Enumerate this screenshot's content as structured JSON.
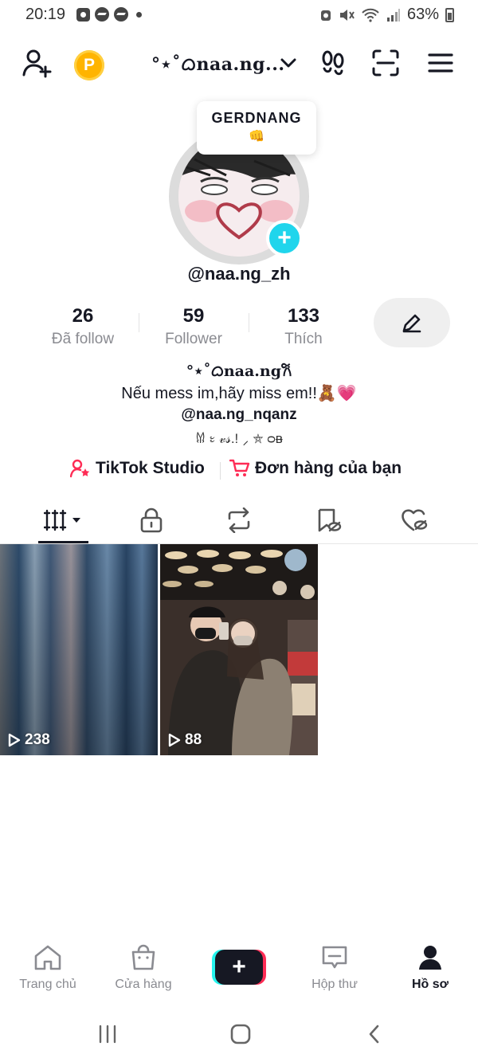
{
  "status_bar": {
    "time": "20:19",
    "battery": "63%"
  },
  "header": {
    "username": "°⋆˚ᜊnaa.ng..."
  },
  "profile": {
    "note": {
      "title": "GERDNANG",
      "emoji": "👊"
    },
    "handle": "@naa.ng_zh",
    "stats": [
      {
        "value": "26",
        "label": "Đã follow"
      },
      {
        "value": "59",
        "label": "Follower"
      },
      {
        "value": "133",
        "label": "Thích"
      }
    ],
    "bio": {
      "line1": "°⋆˚ᜊnaa.ng𐙚",
      "line2": "Nếu mess im,hãy miss em!!🧸💗",
      "line3": "@naa.ng_nqanz",
      "line4": "𐀔 ᭝ 𝓋𝓈.! ⸝ ⛤ ᴑᴃ"
    },
    "links": {
      "studio": "TikTok Studio",
      "orders": "Đơn hàng của bạn"
    }
  },
  "videos": [
    {
      "views": "238"
    },
    {
      "views": "88"
    }
  ],
  "bottom_nav": {
    "home": "Trang chủ",
    "shop": "Cửa hàng",
    "create": "+",
    "inbox": "Hộp thư",
    "profile": "Hồ sơ"
  },
  "colors": {
    "accent_pink": "#fe2c55",
    "accent_cyan": "#25f4ee",
    "badge_blue": "#20d5ec",
    "coin_gold": "#ffb400",
    "text_dark": "#161823",
    "text_muted": "#8a8b91"
  }
}
